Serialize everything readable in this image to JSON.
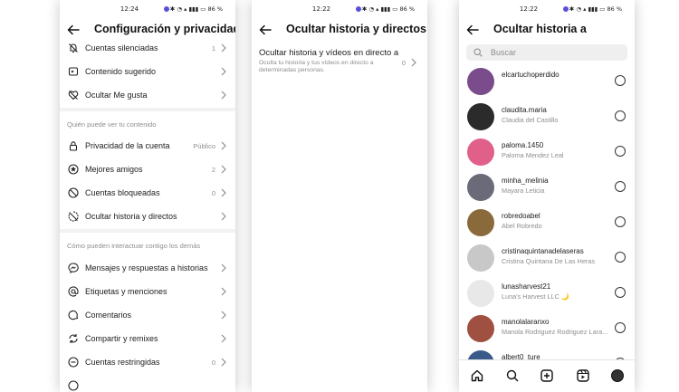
{
  "screen1": {
    "status": {
      "time": "12:24",
      "battery": "86 %"
    },
    "title": "Configuración y privacidad",
    "rows_top": [
      {
        "label": "Cuentas silenciadas",
        "value": "1",
        "icon": "mute-icon"
      },
      {
        "label": "Contenido sugerido",
        "value": "",
        "icon": "suggested-content-icon"
      },
      {
        "label": "Ocultar Me gusta",
        "value": "",
        "icon": "hide-likes-icon"
      }
    ],
    "section1": "Quién puede ver tu contenido",
    "rows_mid": [
      {
        "label": "Privacidad de la cuenta",
        "value": "Público",
        "icon": "lock-icon"
      },
      {
        "label": "Mejores amigos",
        "value": "2",
        "icon": "star-icon"
      },
      {
        "label": "Cuentas bloqueadas",
        "value": "0",
        "icon": "block-icon"
      },
      {
        "label": "Ocultar historia y directos",
        "value": "",
        "icon": "hide-story-icon"
      }
    ],
    "section2": "Cómo pueden interactuar contigo los demás",
    "rows_bottom": [
      {
        "label": "Mensajes y respuestas a historias",
        "value": "",
        "icon": "messenger-icon"
      },
      {
        "label": "Etiquetas y menciones",
        "value": "",
        "icon": "at-icon"
      },
      {
        "label": "Comentarios",
        "value": "",
        "icon": "comment-icon"
      },
      {
        "label": "Compartir y remixes",
        "value": "",
        "icon": "share-remix-icon"
      },
      {
        "label": "Cuentas restringidas",
        "value": "0",
        "icon": "restricted-icon"
      }
    ]
  },
  "screen2": {
    "status": {
      "time": "12:22",
      "battery": "86 %"
    },
    "title": "Ocultar historia y directos",
    "item": {
      "heading": "Ocultar historia y vídeos en directo a",
      "description": "Oculta tu historia y tus vídeos en directo a determinadas personas.",
      "value": "0"
    }
  },
  "screen3": {
    "status": {
      "time": "12:22",
      "battery": "86 %"
    },
    "title": "Ocultar historia a",
    "search_placeholder": "Buscar",
    "users": [
      {
        "username": "elcartuchoperdido",
        "fullname": "",
        "color": "#7a4c8c"
      },
      {
        "username": "claudita.maria",
        "fullname": "Claudia del Castillo",
        "color": "#2b2b2b"
      },
      {
        "username": "paloma.1450",
        "fullname": "Paloma Mendez Leal",
        "color": "#e0608a"
      },
      {
        "username": "minha_melinia",
        "fullname": "Mayara Leticia",
        "color": "#6a6a78"
      },
      {
        "username": "robredoabel",
        "fullname": "Abel Robredo",
        "color": "#8a6a3a"
      },
      {
        "username": "cristinaquintanadelaseras",
        "fullname": "Cristina Quintana De Las Heras",
        "color": "#c8c8c8"
      },
      {
        "username": "lunasharvest21",
        "fullname": "Luna's Harvest LLC 🌙",
        "color": "#e8e8e8"
      },
      {
        "username": "manolalaranxo",
        "fullname": "Manola Rodriguez Rodriguez Lara...",
        "color": "#a05040"
      },
      {
        "username": "albert0_ture",
        "fullname": "",
        "color": "#3a5a8a"
      }
    ]
  }
}
